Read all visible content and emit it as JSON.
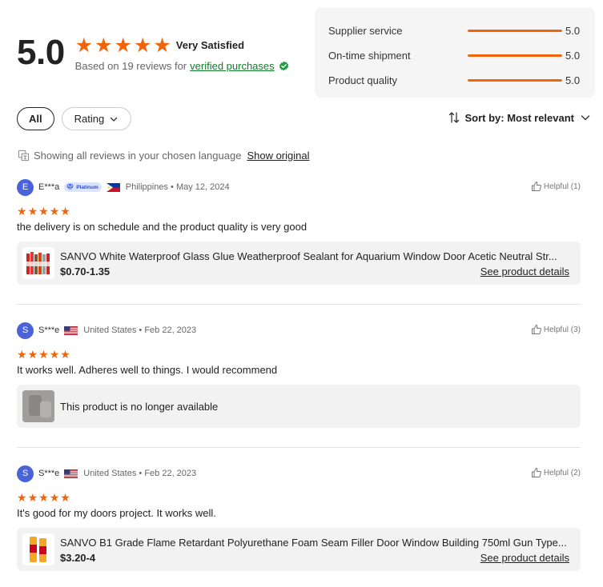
{
  "summary": {
    "score": "5.0",
    "stars": 5,
    "label": "Very Satisfied",
    "based_on": "Based on 19 reviews for",
    "verified": "verified purchases"
  },
  "metrics": [
    {
      "label": "Supplier service",
      "value": "5.0",
      "level": 1.0
    },
    {
      "label": "On-time shipment",
      "value": "5.0",
      "level": 1.0
    },
    {
      "label": "Product quality",
      "value": "5.0",
      "level": 1.0
    }
  ],
  "filters": {
    "all": "All",
    "rating": "Rating",
    "sort": "Sort by: Most relevant"
  },
  "translation": {
    "notice": "Showing all reviews in your chosen language",
    "show_original": "Show original"
  },
  "reviews": [
    {
      "initial": "E",
      "user": "E***a",
      "badge": "Platinum",
      "country": "Philippines",
      "date": "May 12, 2024",
      "helpful": "Helpful (1)",
      "stars": 5,
      "text": "the delivery is on schedule and the product quality is very good",
      "product_title": "SANVO White Waterproof Glass Glue Weatherproof Sealant for Aquarium Window Door Acetic Neutral Str...",
      "product_price": "$0.70-1.35",
      "product_link": "See product details"
    },
    {
      "initial": "S",
      "user": "S***e",
      "country": "United States",
      "date": "Feb 22, 2023",
      "helpful": "Helpful (3)",
      "stars": 5,
      "text": "It works well. Adheres well to things. I would recommend",
      "unavailable": "This product is no longer available"
    },
    {
      "initial": "S",
      "user": "S***e",
      "country": "United States",
      "date": "Feb 22, 2023",
      "helpful": "Helpful (2)",
      "stars": 5,
      "text": "It's good for my doors project. It works well.",
      "product_title": "SANVO B1 Grade Flame Retardant Polyurethane Foam Seam Filler Door Window Building 750ml Gun Type...",
      "product_price": "$3.20-4",
      "product_link": "See product details"
    }
  ],
  "meta_separator": "•",
  "colors": {
    "accent": "#f0640a",
    "verified": "#137a2c",
    "avatar": "#4a63d8"
  }
}
